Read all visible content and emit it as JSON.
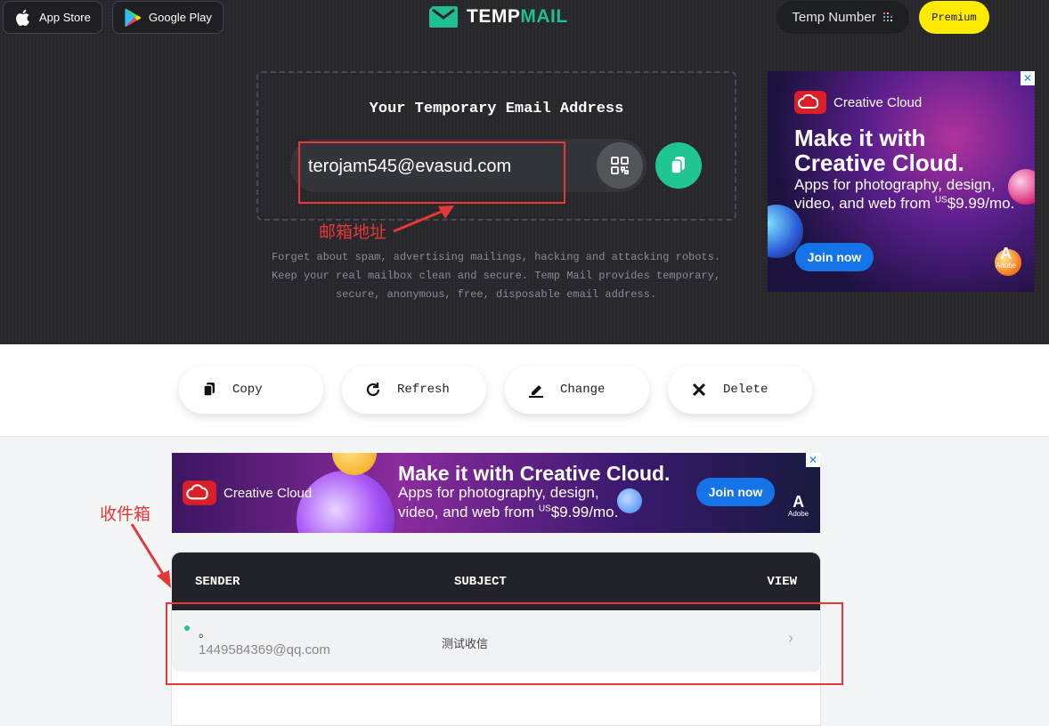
{
  "header": {
    "app_store_label": "App Store",
    "google_play_label": "Google Play",
    "logo_text_part1": "TEMP",
    "logo_text_part2": "MAIL",
    "temp_number_label": "Temp Number",
    "premium_label": "Premium"
  },
  "email": {
    "title": "Your Temporary Email Address",
    "address": "terojam545@evasud.com",
    "annotation": "邮箱地址",
    "description": "Forget about spam, advertising mailings, hacking and attacking robots. Keep your real mailbox clean and secure. Temp Mail provides temporary, secure, anonymous, free, disposable email address."
  },
  "ad_side": {
    "brand": "Creative Cloud",
    "headline_line1": "Make it with",
    "headline_line2": "Creative Cloud.",
    "body_line1": "Apps for photography, design,",
    "body_line2": "video, and web from ",
    "currency": "US",
    "price": "$9.99/mo.",
    "cta": "Join now",
    "adobe": "Adobe"
  },
  "actions": [
    {
      "label": "Copy"
    },
    {
      "label": "Refresh"
    },
    {
      "label": "Change"
    },
    {
      "label": "Delete"
    }
  ],
  "ad_banner": {
    "brand": "Creative Cloud",
    "headline": "Make it with Creative Cloud.",
    "body_line1": "Apps for photography, design,",
    "body_line2": "video, and web from ",
    "currency": "US",
    "price": "$9.99/mo.",
    "cta": "Join now",
    "adobe": "Adobe"
  },
  "inbox": {
    "annotation": "收件箱",
    "col_sender": "SENDER",
    "col_subject": "SUBJECT",
    "col_view": "VIEW",
    "messages": [
      {
        "sender_name": "。",
        "sender_email": "1449584369@qq.com",
        "subject": "测试收信"
      }
    ]
  },
  "colors": {
    "accent": "#20c58f",
    "premium": "#ffeb00",
    "annotation": "#e53935"
  }
}
